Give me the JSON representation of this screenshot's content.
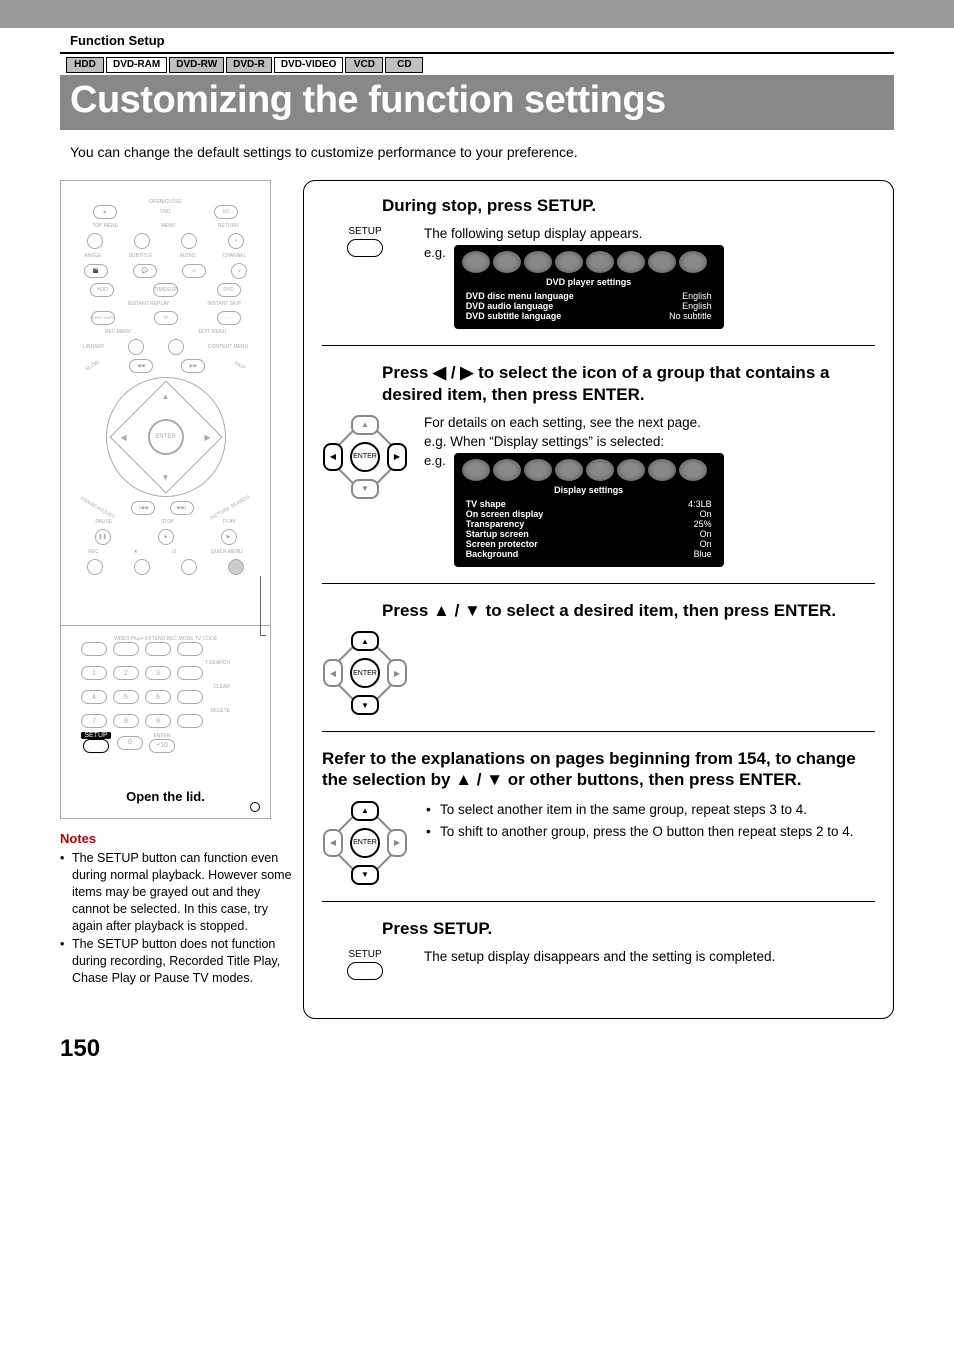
{
  "header": {
    "function_setup": "Function Setup",
    "title": "Customizing the function settings",
    "intro": "You can change the default settings to customize performance to your preference.",
    "categories": [
      "HDD",
      "DVD-RAM",
      "DVD-RW",
      "DVD-R",
      "DVD-VIDEO",
      "VCD",
      "CD"
    ],
    "cat_styles": [
      "grey",
      "white",
      "grey",
      "grey",
      "white",
      "grey",
      "grey"
    ]
  },
  "remote": {
    "open_close": "OPEN/CLOSE",
    "dvd": "DVD",
    "top_menu": "TOP MENU",
    "menu": "MENU",
    "return": "RETURN",
    "angle": "ANGLE",
    "subtitle": "SUBTITLE",
    "audio": "AUDIO",
    "channel": "CHANNEL",
    "hdd": "HDD",
    "timeslip": "TIMESLIP",
    "dvd2": "DVD",
    "instant_replay": "INSTANT REPLAY",
    "instant_skip": "INSTANT SKIP",
    "easy_navi": "EASY\nNAVI",
    "rec_menu": "REC MENU",
    "edit_menu": "EDIT MENU",
    "library": "LIBRARY",
    "content_menu": "CONTENT MENU",
    "slow": "SLOW",
    "skip": "SKIP",
    "enter": "ENTER",
    "frame_adjust": "FRAME/ADJUST",
    "picture_search": "PICTURE SEARCH",
    "pause": "PAUSE",
    "stop": "STOP",
    "play": "PLAY",
    "rec": "REC",
    "star": "★",
    "o": "O",
    "quick_menu": "QUICK MENU",
    "open_lid": "Open the lid.",
    "video_plus": "VIDEO Plus+",
    "extend": "EXTEND",
    "rec_mode": "REC MODE",
    "tv_code": "TV CODE",
    "t_search": "T.SEARCH",
    "clear": "CLEAR",
    "delete": "DELETE",
    "setup": "SETUP",
    "enter2": "ENTER",
    "plus10": "+10"
  },
  "steps": {
    "s1": {
      "heading": "During stop, press SETUP.",
      "sub": "The following setup display appears.",
      "eg": "e.g.",
      "btn": "SETUP",
      "osd_title": "DVD player settings",
      "rows": [
        [
          "DVD disc menu language",
          "English"
        ],
        [
          "DVD audio language",
          "English"
        ],
        [
          "DVD subtitle language",
          "No subtitle"
        ]
      ]
    },
    "s2": {
      "heading": "Press ◀ / ▶ to select the icon of a group that contains a desired item, then press ENTER.",
      "sub1": "For details on each setting, see the next page.",
      "sub2": "e.g. When “Display settings” is selected:",
      "eg": "e.g.",
      "enter": "ENTER",
      "osd_title": "Display settings",
      "rows": [
        [
          "TV shape",
          "4:3LB"
        ],
        [
          "On screen display",
          "On"
        ],
        [
          "Transparency",
          "25%"
        ],
        [
          "Startup screen",
          "On"
        ],
        [
          "Screen protector",
          "On"
        ],
        [
          "Background",
          "Blue"
        ]
      ]
    },
    "s3": {
      "heading": "Press ▲ / ▼ to select a desired item, then press ENTER.",
      "enter": "ENTER"
    },
    "s4": {
      "heading": "Refer to the explanations on pages beginning from 154, to change the selection by ▲ / ▼ or other buttons, then press ENTER.",
      "b1": "To select another item in the same group, repeat steps 3 to 4.",
      "b2": "To shift to another group, press the O button then repeat steps 2 to 4.",
      "enter": "ENTER"
    },
    "s5": {
      "heading": "Press SETUP.",
      "sub": "The setup display disappears and the setting is completed.",
      "btn": "SETUP"
    }
  },
  "notes": {
    "h": "Notes",
    "n1": "The SETUP button can function even during normal playback. However some items may be grayed out and they cannot be selected. In this case, try again after playback is stopped.",
    "n2": "The SETUP button does not function during recording, Recorded Title Play, Chase Play or Pause TV modes."
  },
  "page_number": "150"
}
